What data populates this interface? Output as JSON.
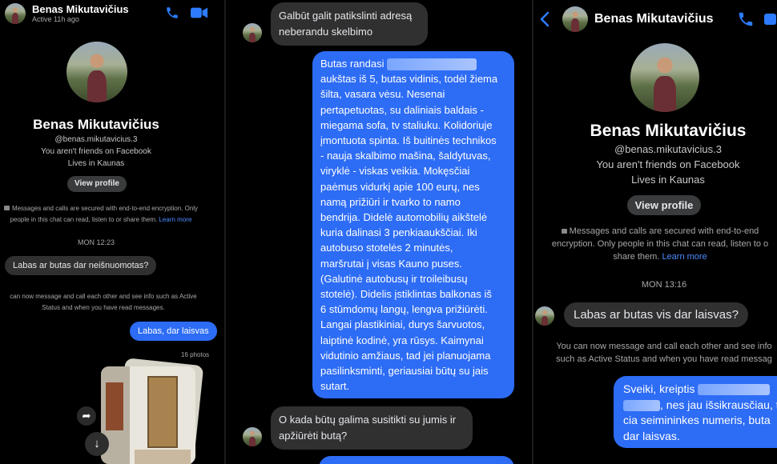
{
  "left_panel": {
    "header_name": "Benas Mikutavičius",
    "header_status": "Active 11h ago",
    "profile_name": "Benas Mikutavičius",
    "username": "@benas.mikutavicius.3",
    "friend_status": "You aren't friends on Facebook",
    "lives_in": "Lives in Kaunas",
    "view_profile": "View profile",
    "encryption_line1": "Messages and calls are secured with end-to-end encryption. Only",
    "encryption_line2": "people in this chat can read, listen to or share them.",
    "learn_more": "Learn more",
    "timestamp": "MON 12:23",
    "msg_in": "Labas ar butas dar neišnuomotas?",
    "info_line1": "can now message and call each other and see info such as Active",
    "info_line2": "Status and when you have read messages.",
    "msg_out": "Labas, dar laisvas",
    "photo_count": "16 photos"
  },
  "middle_panel": {
    "msg_in_top": [
      "Galbūt galit patikslinti adresą",
      "neberandu skelbimo"
    ],
    "msg_out_first_line": "Butas randasi",
    "msg_out_lines": [
      "aukštas iš 5, butas vidinis, todėl žiema",
      "šilta, vasara vėsu. Nesenai",
      "pertapetuotas, su daliniais baldais -",
      "miegama sofa, tv staliuku. Kolidoriuje",
      "įmontuota spinta. Iš buitinės technikos",
      "- nauja skalbimo mašina, šaldytuvas,",
      "viryklė - viskas veikia. Mokęsčiai",
      "paėmus vidurkį apie 100 eurų, nes",
      "namą prižiūri ir tvarko to namo",
      "bendrija. Didelė automobilių aikštelė",
      "kuria dalinasi 3 penkiaaukščiai. Iki",
      "autobuso stotelės 2 minutės,",
      "maršrutai į visas Kauno puses.",
      "(Galutinė autobusų ir troileibusų",
      "stotelė). Didelis įstiklintas balkonas iš",
      "6 stūmdomų langų, lengva prižiūrėti.",
      "Langai plastikiniai, durys šarvuotos,",
      "laiptinė kodinė, yra rūsys. Kaimynai",
      "vidutinio amžiaus, tad jei planuojama",
      "pasilinksminti, geriausiai būtų  su jais",
      "sutart."
    ],
    "msg_in_bottom": [
      "O kada būtų galima susitikti su jumis ir",
      "apžiūrėti butą?"
    ]
  },
  "right_panel": {
    "header_name": "Benas Mikutavičius",
    "profile_name": "Benas Mikutavičius",
    "username": "@benas.mikutavicius.3",
    "friend_status": "You aren't friends on Facebook",
    "lives_in": "Lives in Kaunas",
    "view_profile": "View profile",
    "encryption_line1": "Messages and calls are secured with end-to-end",
    "encryption_line2": "encryption. Only people in this chat can read, listen to o",
    "encryption_line3": "share them.",
    "learn_more": "Learn more",
    "timestamp": "MON 13:16",
    "msg_in": "Labas ar butas vis dar laisvas?",
    "info_line1": "You can now message and call each other and see info",
    "info_line2": "such as Active Status and when you have read messag",
    "msg_out_line1": "Sveiki, kreiptis",
    "msg_out_line2": ", nes jau išsikrausčiau, ta",
    "msg_out_line3": "cia seimininkes numeris, buta",
    "msg_out_line4": "dar laisvas."
  },
  "colors": {
    "accent": "#2d6cf5",
    "incoming_bubble": "#303030",
    "link": "#4d8bff",
    "background": "#000000"
  }
}
